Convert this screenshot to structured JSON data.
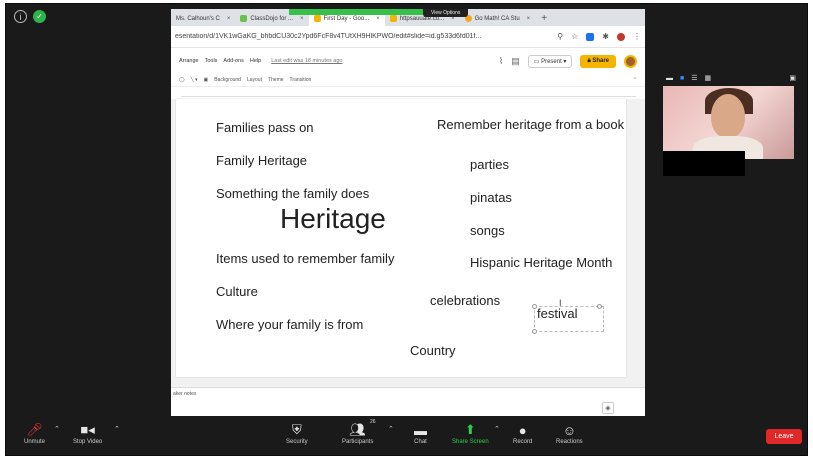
{
  "browser": {
    "tabs": [
      {
        "label": "Ms. Calhoun's C",
        "icon": "document-icon",
        "color": "#e8a23a"
      },
      {
        "label": "ClassDojo for ...",
        "icon": "classdojo-icon",
        "color": "#66c24a"
      },
      {
        "label": "First Day - Goo...",
        "icon": "slides-icon",
        "color": "#f4b400"
      },
      {
        "label": "httpsauuate.co...",
        "icon": "link-icon",
        "color": "#f4b400"
      },
      {
        "label": "Go Math! CA Stu",
        "icon": "gomath-icon",
        "color": "#f5a623"
      }
    ],
    "view_options": "View Options",
    "url": "esentation/d/1VK1wGaKG_bhbdCU30c2Ypd6FcF8v4TUtXH9HlKPWO/edit#slide=id.g533d6fd01f..."
  },
  "slides_ui": {
    "menu": [
      "Arrange",
      "Tools",
      "Add-ons",
      "Help"
    ],
    "last_edit": "Last edit was 18 minutes ago",
    "present_label": "Present",
    "share_label": "Share",
    "format_items": [
      "Background",
      "Layout",
      "Theme",
      "Transition"
    ],
    "speaker_notes": "aker notes"
  },
  "slide": {
    "words": [
      {
        "text": "Families pass on",
        "size": "normal"
      },
      {
        "text": "Remember heritage from a book",
        "size": "normal"
      },
      {
        "text": "Family Heritage",
        "size": "normal"
      },
      {
        "text": "parties",
        "size": "normal"
      },
      {
        "text": "Something the family does",
        "size": "normal"
      },
      {
        "text": "pinatas",
        "size": "normal"
      },
      {
        "text": "Heritage",
        "size": "big"
      },
      {
        "text": "songs",
        "size": "normal"
      },
      {
        "text": "Items used to remember family",
        "size": "normal"
      },
      {
        "text": "Hispanic Heritage Month",
        "size": "normal"
      },
      {
        "text": "Culture",
        "size": "normal"
      },
      {
        "text": "celebrations",
        "size": "normal"
      },
      {
        "text": "festival",
        "size": "normal"
      },
      {
        "text": "Where your family is from",
        "size": "normal"
      },
      {
        "text": "Country",
        "size": "normal"
      }
    ]
  },
  "zoom": {
    "controls": {
      "unmute": "Unmute",
      "stop_video": "Stop Video",
      "security": "Security",
      "participants": "Participants",
      "participants_count": "26",
      "chat": "Chat",
      "share_screen": "Share Screen",
      "record": "Record",
      "reactions": "Reactions",
      "leave": "Leave"
    },
    "share_color": "#2bd04f",
    "leave_color": "#e02828"
  }
}
